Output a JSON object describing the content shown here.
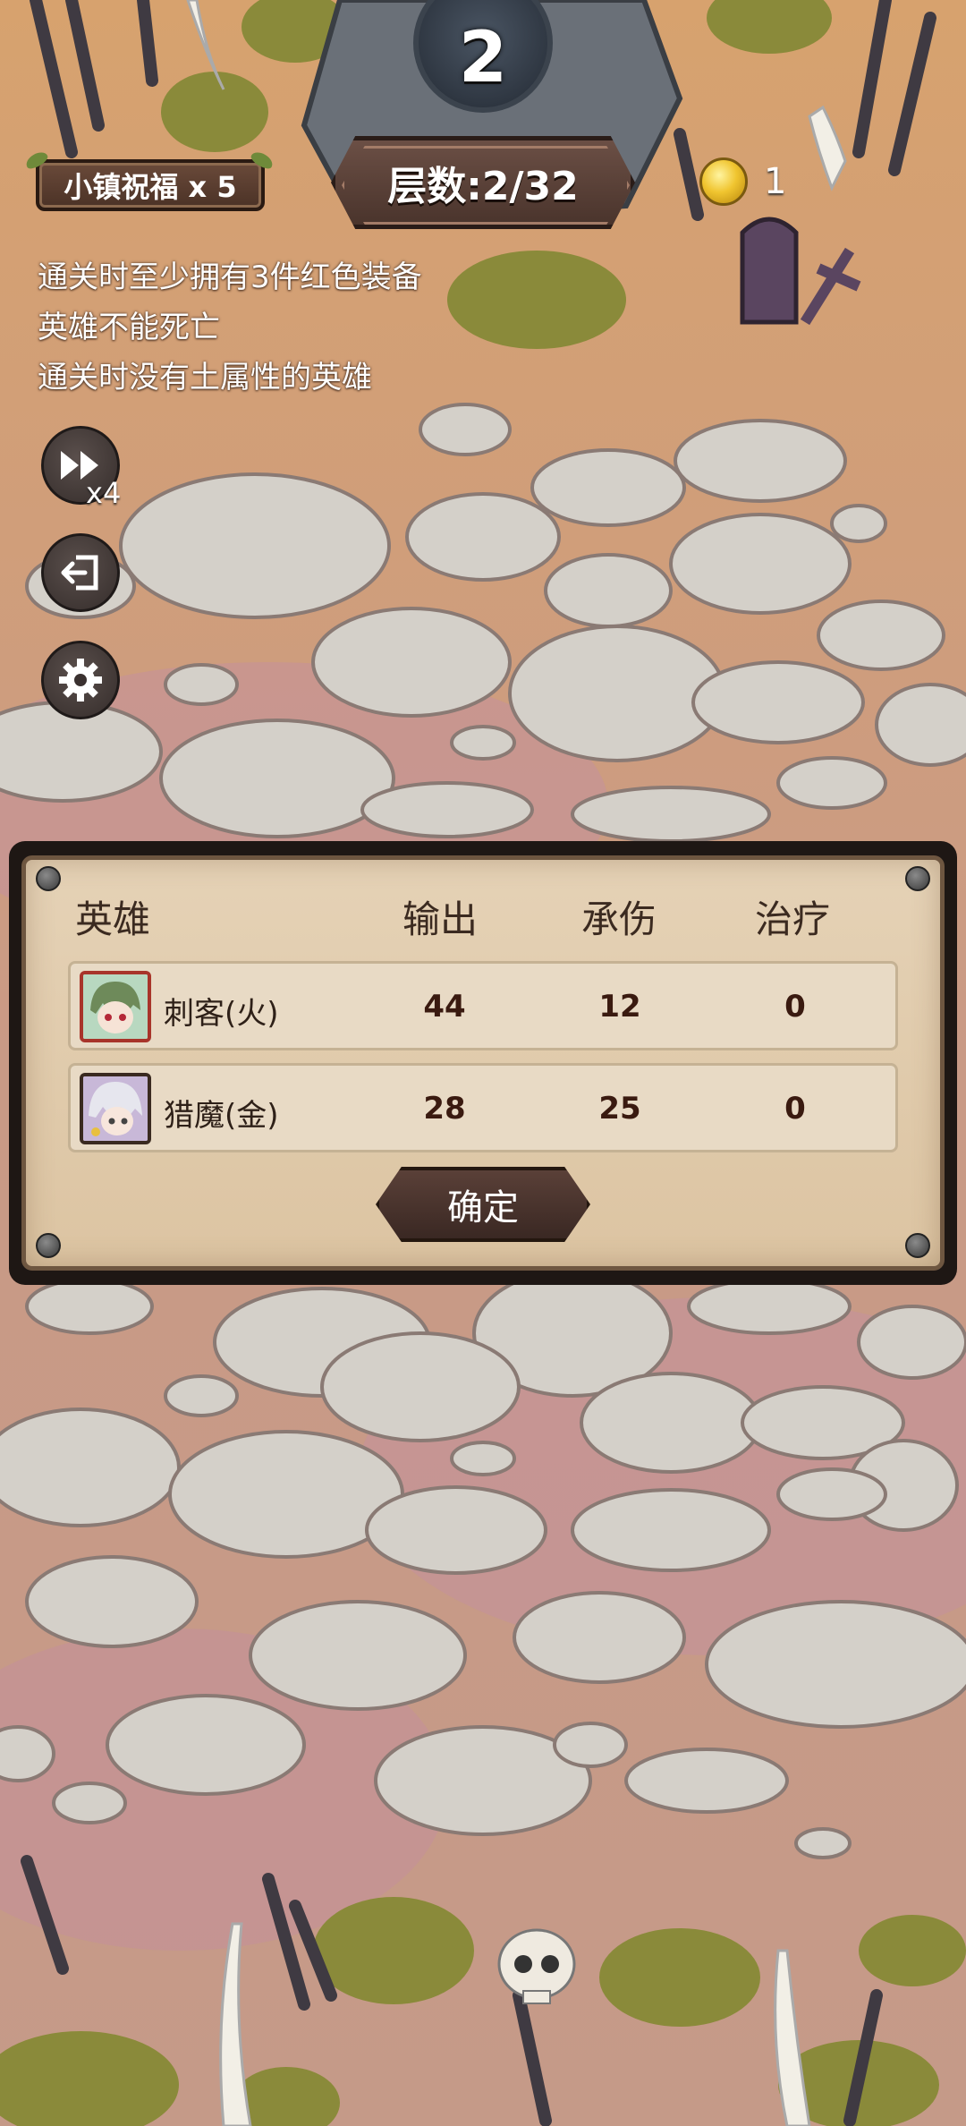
{
  "round": {
    "number": "2"
  },
  "blessing": {
    "label": "小镇祝福 x 5"
  },
  "floor": {
    "label": "层数:2/32"
  },
  "currency": {
    "coins": "1",
    "icon": "gold-coin-icon"
  },
  "tasks": [
    "通关时至少拥有3件红色装备",
    "英雄不能死亡",
    "通关时没有土属性的英雄"
  ],
  "controls": {
    "speed_label": "x4",
    "speed_icon": "fast-forward-icon",
    "exit_icon": "exit-icon",
    "settings_icon": "gear-icon"
  },
  "stats_panel": {
    "headers": {
      "hero": "英雄",
      "output": "输出",
      "damage_taken": "承伤",
      "healing": "治疗"
    },
    "rows": [
      {
        "name": "刺客(火)",
        "output": "44",
        "damage_taken": "12",
        "healing": "0",
        "frame_color": "#a8342a"
      },
      {
        "name": "猎魔(金)",
        "output": "28",
        "damage_taken": "25",
        "healing": "0",
        "frame_color": "#c89a3a"
      }
    ],
    "confirm_label": "确定"
  }
}
